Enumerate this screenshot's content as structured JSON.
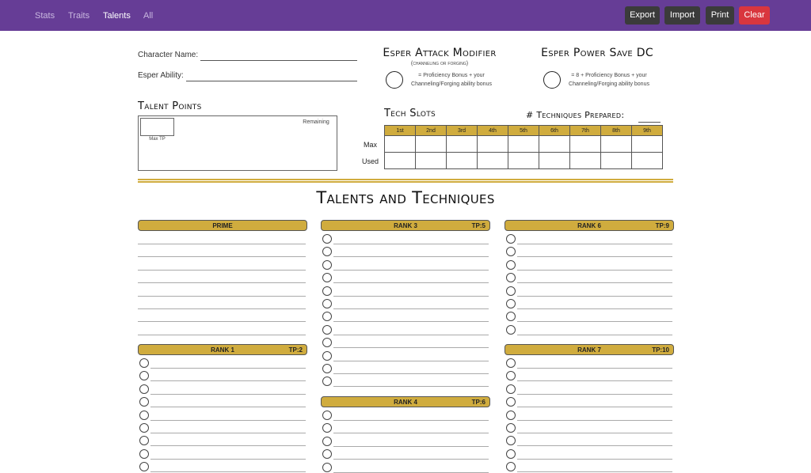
{
  "nav": [
    {
      "label": "Stats",
      "active": false
    },
    {
      "label": "Traits",
      "active": false
    },
    {
      "label": "Talents",
      "active": true
    },
    {
      "label": "All",
      "active": false
    }
  ],
  "toolbar": {
    "export": "Export",
    "import": "Import",
    "print": "Print",
    "clear": "Clear"
  },
  "colors": {
    "topbar": "#663d96",
    "gold": "#d0ac3e",
    "danger": "#d9363e",
    "dark_button": "#3b3b3b"
  },
  "sheet": {
    "character_name_label": "Character Name:",
    "esper_ability_label": "Esper Ability:",
    "attack_modifier": {
      "title": "Esper Attack Modifier",
      "subtitle": "(channeling or forging)",
      "formula_line1": "= Proficiency Bonus + your",
      "formula_line2": "Channeling/Forging ability bonus"
    },
    "power_save": {
      "title": "Esper Power Save DC",
      "formula_line1": "= 8 + Proficiency Bonus + your",
      "formula_line2": "Channeling/Forging ability bonus"
    },
    "talent_points": {
      "title": "Talent Points",
      "remaining_label": "Remaining",
      "max_label": "Max TP"
    },
    "tech_slots": {
      "title": "Tech Slots",
      "levels": [
        "1st",
        "2nd",
        "3rd",
        "4th",
        "5th",
        "6th",
        "7th",
        "8th",
        "9th"
      ],
      "row_labels": [
        "Max",
        "Used"
      ]
    },
    "techniques_prepared_label": "# Techniques Prepared:",
    "section_title": "Talents and Techniques",
    "ranks": [
      {
        "name": "PRIME",
        "tp": ""
      },
      {
        "name": "RANK 1",
        "tp": "TP:2"
      },
      {
        "name": "RANK 3",
        "tp": "TP:5"
      },
      {
        "name": "RANK 4",
        "tp": "TP:6"
      },
      {
        "name": "RANK 6",
        "tp": "TP:9"
      },
      {
        "name": "RANK 7",
        "tp": "TP:10"
      }
    ]
  }
}
